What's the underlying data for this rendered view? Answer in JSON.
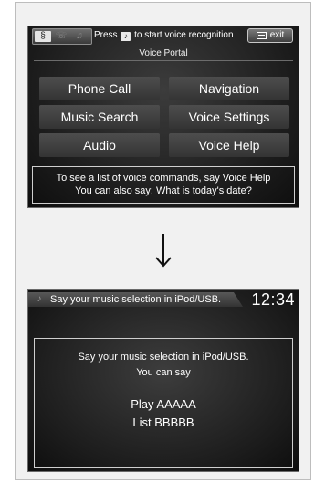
{
  "screen1": {
    "tabs": [
      {
        "icon": "voice-portal-tab-icon",
        "glyph": "§",
        "active": true
      },
      {
        "icon": "phone-tab-icon",
        "glyph": "☏",
        "active": false
      },
      {
        "icon": "audio-tab-icon",
        "glyph": "♫",
        "active": false
      }
    ],
    "prompt_before": "Press",
    "prompt_after": "to start voice recognition",
    "talk_glyph": "♪",
    "exit_label": "exit",
    "title": "Voice Portal",
    "buttons": [
      "Phone Call",
      "Navigation",
      "Music Search",
      "Voice Settings",
      "Audio",
      "Voice Help"
    ],
    "hint_line1": "To see a list of voice commands, say Voice Help",
    "hint_line2": "You can also say: What is today's date?"
  },
  "screen2": {
    "title": "Say your music selection in iPod/USB.",
    "clock": "12:34",
    "message_line1": "Say your music selection in iPod/USB.",
    "message_line2": "You can say",
    "command1": "Play AAAAA",
    "command2": "List BBBBB"
  },
  "colors": {
    "screen_bg": "#1b1b1b",
    "button_bg": "#3f3f3f",
    "text": "#ffffff",
    "frame_bg": "#f1f1f1"
  }
}
